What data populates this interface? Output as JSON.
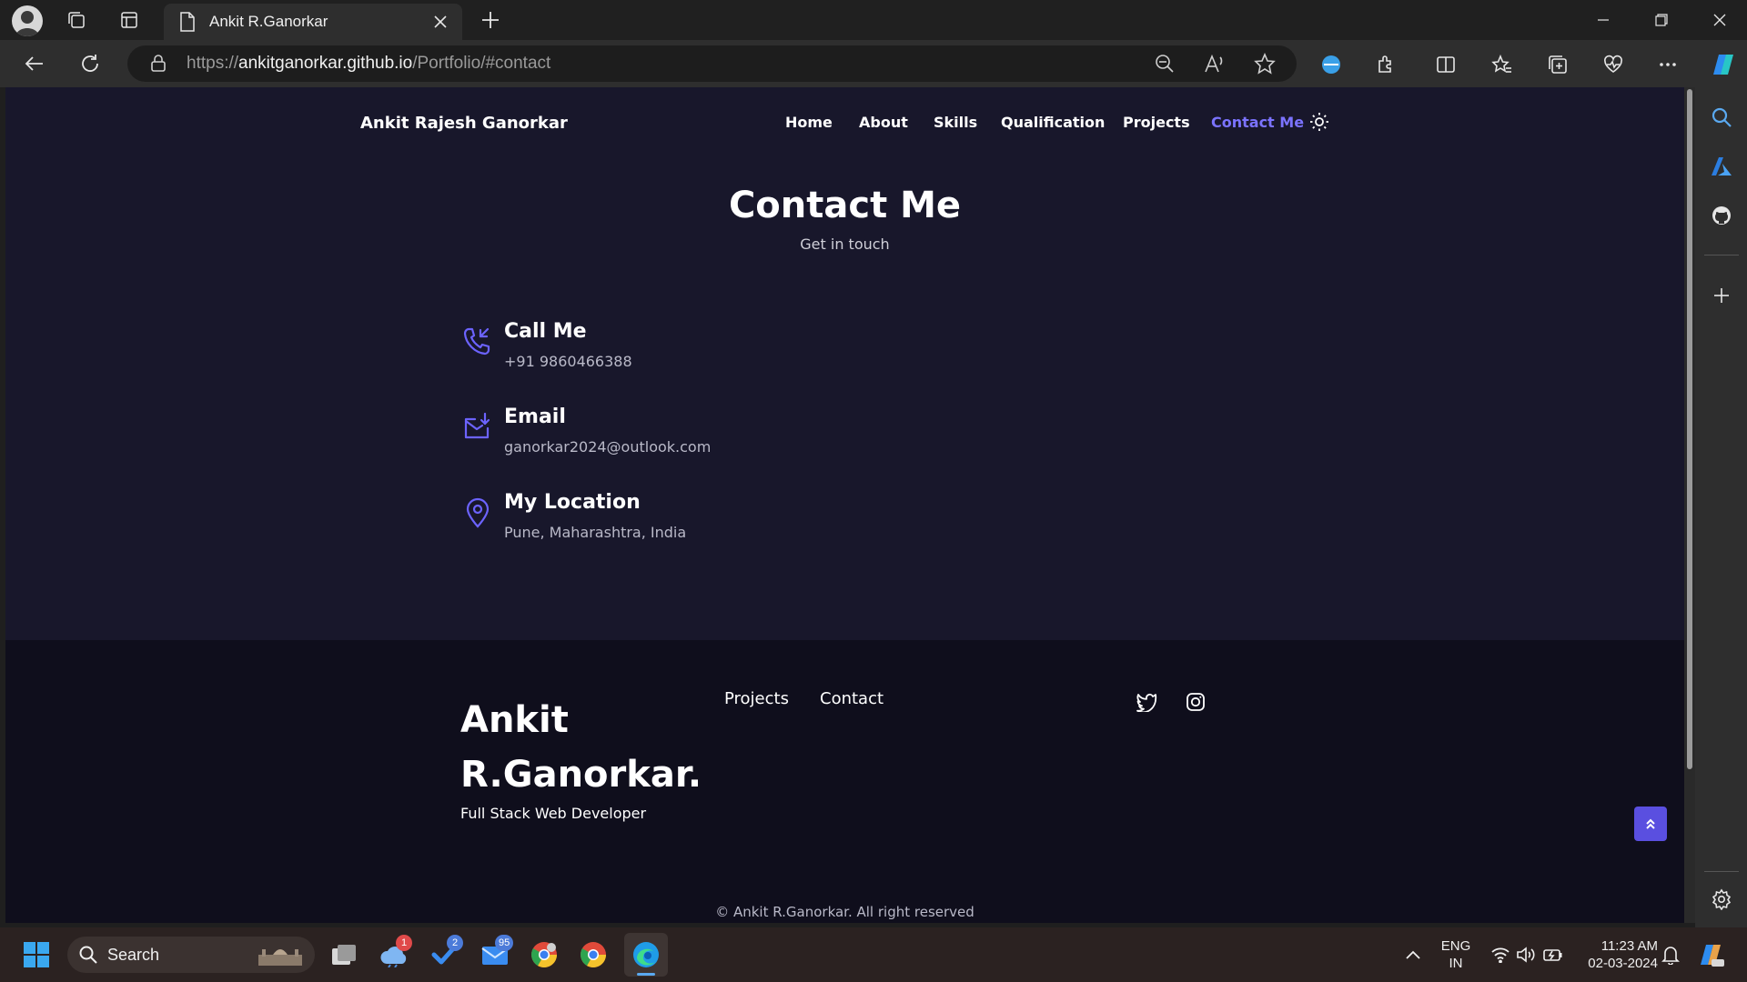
{
  "browser": {
    "tab_title": "Ankit R.Ganorkar",
    "url_prefix": "https://",
    "url_host": "ankitganorkar.github.io",
    "url_path": "/Portfolio/#contact"
  },
  "site": {
    "brand": "Ankit Rajesh Ganorkar",
    "nav": [
      "Home",
      "About",
      "Skills",
      "Qualification",
      "Projects",
      "Contact Me"
    ],
    "active_nav": "Contact Me",
    "accent_color": "#6c63ff"
  },
  "contact": {
    "title": "Contact Me",
    "subtitle": "Get in touch",
    "items": [
      {
        "title": "Call Me",
        "value": "+91 9860466388",
        "icon": "phone-icon"
      },
      {
        "title": "Email",
        "value": "ganorkar2024@outlook.com",
        "icon": "mail-icon"
      },
      {
        "title": "My Location",
        "value": "Pune, Maharashtra, India",
        "icon": "location-pin-icon"
      }
    ]
  },
  "footer": {
    "name_line1": "Ankit",
    "name_line2": "R.Ganorkar.",
    "role": "Full Stack Web Developer",
    "links": [
      "Projects",
      "Contact"
    ],
    "social": [
      "twitter-icon",
      "instagram-icon"
    ],
    "copyright": "© Ankit R.Ganorkar. All right reserved"
  },
  "taskbar": {
    "search_label": "Search",
    "badges": {
      "weather": "1",
      "todo": "2",
      "mail": "95"
    },
    "lang_line1": "ENG",
    "lang_line2": "IN",
    "time": "11:23 AM",
    "date": "02-03-2024"
  }
}
